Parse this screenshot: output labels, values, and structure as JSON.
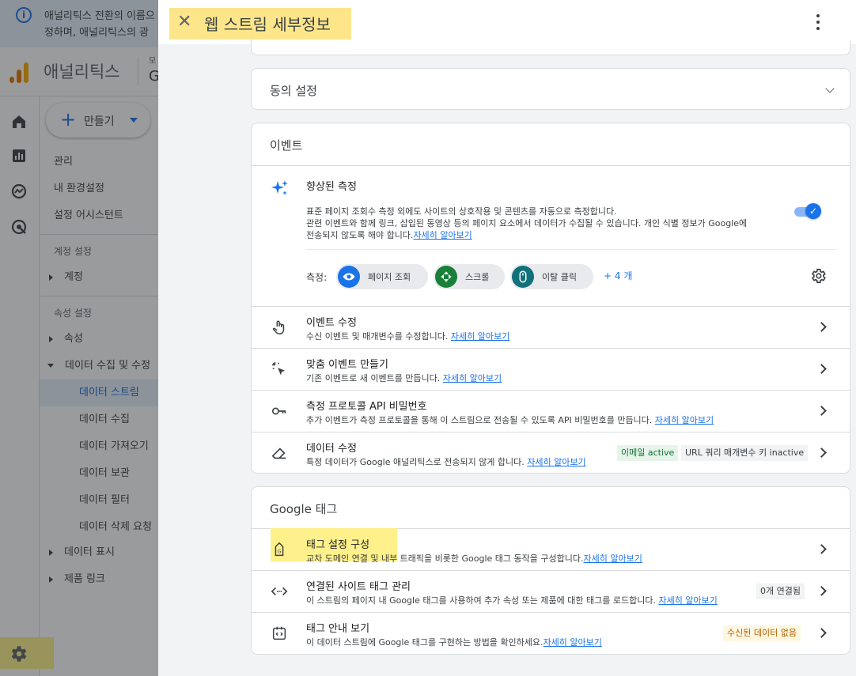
{
  "background": {
    "banner_line1": "애널리틱스 전환의 이름으",
    "banner_line2": "정하며, 애널리틱스의 광",
    "app_name": "애널리틱스",
    "account_small": "모",
    "account_large": "G",
    "create_label": "만들기",
    "nav": {
      "admin": "관리",
      "my_settings": "내 환경설정",
      "setup_assistant": "설정 어시스턴트",
      "account_settings_header": "계정 설정",
      "account": "계정",
      "property_settings_header": "속성 설정",
      "property": "속성",
      "data_collection": "데이터 수집 및 수정",
      "data_streams": "데이터 스트림",
      "data_collection_sub": "데이터 수집",
      "data_import": "데이터 가져오기",
      "data_retention": "데이터 보관",
      "data_filters": "데이터 필터",
      "data_deletion": "데이터 삭제 요청",
      "data_display": "데이터 표시",
      "product_links": "제품 링크"
    }
  },
  "panel": {
    "title": "웹 스트림 세부정보",
    "consent_title": "동의 설정",
    "events": {
      "section_title": "이벤트",
      "enhanced_title": "향상된 측정",
      "enhanced_desc_1": "표준 페이지 조회수 측정 외에도 사이트의 상호작용 및 콘텐츠를 자동으로 측정합니다.",
      "enhanced_desc_2": "관련 이벤트와 함께 링크, 삽입된 동영상 등의 페이지 요소에서 데이터가 수집될 수 있습니다. 개인 식별 정보가 Google에",
      "enhanced_desc_3": "전송되지 않도록 해야 합니다.",
      "learn_more": "자세히 알아보기",
      "measuring_label": "측정:",
      "chips": [
        "페이지 조회",
        "스크롤",
        "이탈 클릭"
      ],
      "more": "+ 4 개",
      "rows": [
        {
          "title": "이벤트 수정",
          "desc": "수신 이벤트 및 매개변수를 수정합니다.",
          "link": "자세히 알아보기"
        },
        {
          "title": "맞춤 이벤트 만들기",
          "desc": "기존 이벤트로 새 이벤트를 만듭니다.",
          "link": "자세히 알아보기"
        },
        {
          "title": "측정 프로토콜 API 비밀번호",
          "desc": "추가 이벤트가 측정 프로토콜을 통해 이 스트림으로 전송될 수 있도록 API 비밀번호를 만듭니다.",
          "link": "자세히 알아보기"
        },
        {
          "title": "데이터 수정",
          "desc": "특정 데이터가 Google 애널리틱스로 전송되지 않게 합니다.",
          "link": "자세히 알아보기",
          "badge1": "이메일 active",
          "badge2": "URL 쿼리 매개변수 키 inactive"
        }
      ]
    },
    "google_tag": {
      "section_title": "Google 태그",
      "rows": [
        {
          "title": "태그 설정 구성",
          "desc": "교차 도메인 연결 및 내부 트래픽을 비롯한 Google 태그 동작을 구성합니다.",
          "link": "자세히 알아보기"
        },
        {
          "title": "연결된 사이트 태그 관리",
          "desc": "이 스트림의 페이지 내 Google 태그를 사용하여 추가 속성 또는 제품에 대한 태그를 로드합니다.",
          "link": "자세히 알아보기",
          "badge": "0개 연결됨"
        },
        {
          "title": "태그 안내 보기",
          "desc": "이 데이터 스트림에 Google 태그를 구현하는 방법을 확인하세요.",
          "link": "자세히 알아보기",
          "badge": "수신된 데이터 없음"
        }
      ]
    }
  },
  "colors": {
    "accent": "#1a73e8",
    "highlight": "#fde68a"
  }
}
